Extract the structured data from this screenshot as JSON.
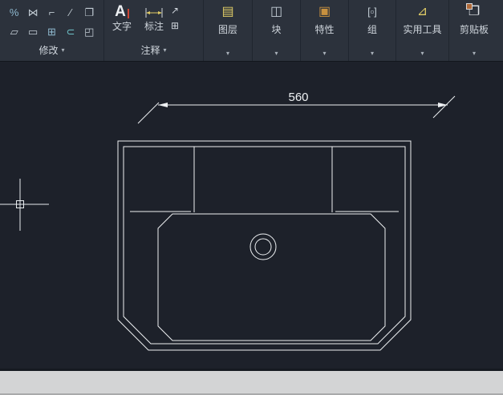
{
  "colors": {
    "ribbon_bg": "#2c323c",
    "canvas_bg": "#1d212a",
    "line": "#eef1f3",
    "accent_yellow": "#dfcb66",
    "bottom_bar": "#d3d4d5"
  },
  "ribbon": {
    "modify": {
      "label": "修改",
      "dropdown": "▾",
      "icons": [
        {
          "name": "break",
          "glyph": "%"
        },
        {
          "name": "mirror",
          "glyph": "⋈"
        },
        {
          "name": "fillet",
          "glyph": "⌐"
        },
        {
          "name": "chamfer",
          "glyph": "∕"
        },
        {
          "name": "copy",
          "glyph": "❐"
        },
        {
          "name": "stretch",
          "glyph": "▱"
        },
        {
          "name": "scale",
          "glyph": "▭"
        },
        {
          "name": "array",
          "glyph": "⊞"
        },
        {
          "name": "offset",
          "glyph": "⊂"
        },
        {
          "name": "explode",
          "glyph": "◰"
        }
      ]
    },
    "annotate": {
      "label": "注释",
      "dropdown": "▾",
      "text_button": {
        "label": "文字",
        "glyph": "A"
      },
      "dim_button": {
        "label": "标注"
      },
      "leader": {
        "glyph": "↗"
      },
      "table": {
        "glyph": "⊞"
      }
    },
    "panels": [
      {
        "id": "layers",
        "label": "图层",
        "glyph": "▤",
        "dropdown": "▾"
      },
      {
        "id": "block",
        "label": "块",
        "glyph": "◫",
        "dropdown": "▾"
      },
      {
        "id": "properties",
        "label": "特性",
        "glyph": "▣",
        "dropdown": "▾"
      },
      {
        "id": "group",
        "label": "组",
        "glyph": "[▫]",
        "dropdown": "▾"
      },
      {
        "id": "utilities",
        "label": "实用工具",
        "glyph": "⊿",
        "dropdown": "▾"
      },
      {
        "id": "clipboard",
        "label": "剪贴板",
        "glyph": "❐",
        "dropdown": "▾"
      }
    ]
  },
  "canvas": {
    "dimension": {
      "value": "560"
    }
  }
}
